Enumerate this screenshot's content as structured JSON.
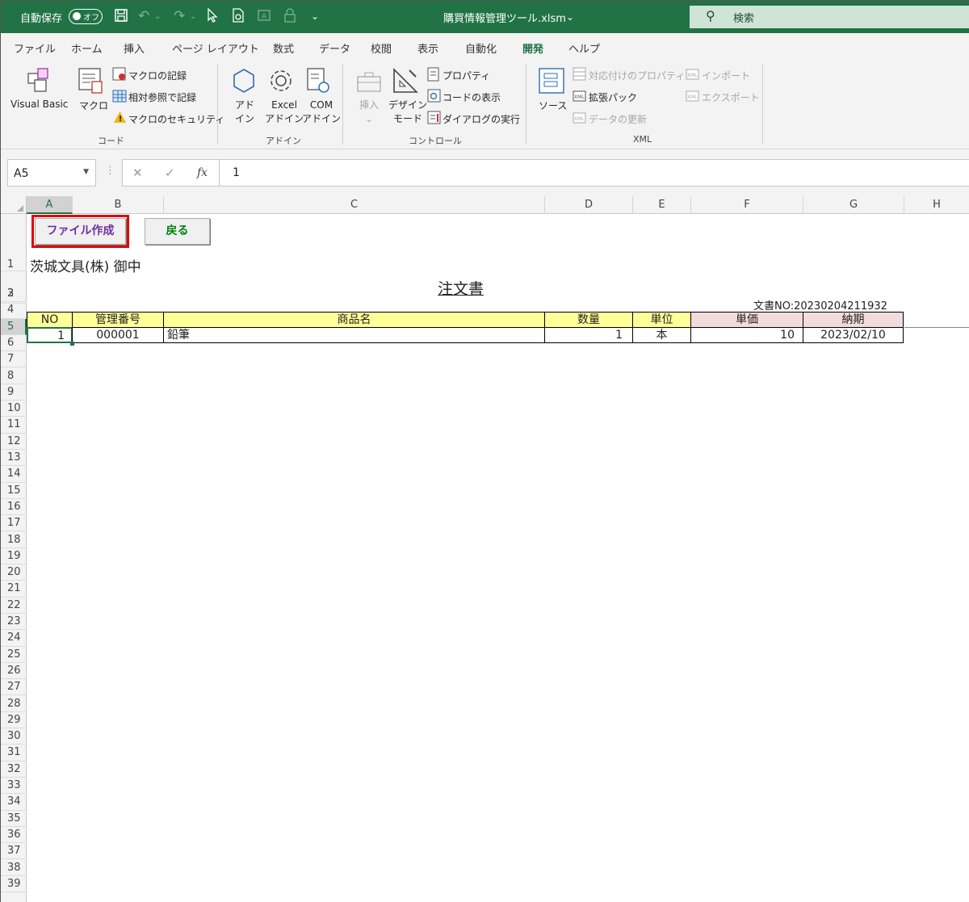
{
  "titlebar": {
    "autosave_label": "自動保存",
    "toggle_label": "オフ",
    "filename": "購買情報管理ツール.xlsm",
    "search_placeholder": "検索"
  },
  "tabs": [
    {
      "label": "ファイル"
    },
    {
      "label": "ホーム"
    },
    {
      "label": "挿入"
    },
    {
      "label": "ページ レイアウト"
    },
    {
      "label": "数式"
    },
    {
      "label": "データ"
    },
    {
      "label": "校閲"
    },
    {
      "label": "表示"
    },
    {
      "label": "自動化"
    },
    {
      "label": "開発",
      "active": true
    },
    {
      "label": "ヘルプ"
    }
  ],
  "ribbon": {
    "code": {
      "visual_basic": "Visual Basic",
      "macro": "マクロ",
      "record_macro": "マクロの記録",
      "relative_ref": "相対参照で記録",
      "macro_security": "マクロのセキュリティ",
      "group_label": "コード"
    },
    "addins": {
      "addin_l1": "アド",
      "addin_l2": "イン",
      "excel_l1": "Excel",
      "excel_l2": "アドイン",
      "com_l1": "COM",
      "com_l2": "アドイン",
      "group_label": "アドイン"
    },
    "controls": {
      "insert": "挿入",
      "design_l1": "デザイン",
      "design_l2": "モード",
      "properties": "プロパティ",
      "view_code": "コードの表示",
      "run_dialog": "ダイアログの実行",
      "group_label": "コントロール"
    },
    "xml": {
      "source": "ソース",
      "map_properties": "対応付けのプロパティ",
      "expansion_packs": "拡張パック",
      "refresh_data": "データの更新",
      "import": "インポート",
      "export": "エクスポート",
      "group_label": "XML"
    }
  },
  "formula_bar": {
    "name_box": "A5",
    "fx": "fx",
    "value": "1"
  },
  "columns": [
    "A",
    "B",
    "C",
    "D",
    "E",
    "F",
    "G",
    "H"
  ],
  "rows": [
    "1",
    "2",
    "3",
    "4",
    "5",
    "6",
    "7",
    "8",
    "9",
    "10",
    "11",
    "12",
    "13",
    "14",
    "15",
    "16",
    "17",
    "18",
    "19",
    "20",
    "21",
    "22",
    "23",
    "24",
    "25",
    "26",
    "27",
    "28",
    "29",
    "30",
    "31",
    "32",
    "33",
    "34",
    "35",
    "36",
    "37",
    "38",
    "39"
  ],
  "sheet": {
    "create_file_button": "ファイル作成",
    "back_button": "戻る",
    "addressee": "茨城文具(株) 御中",
    "title": "注文書",
    "doc_no": "文書NO:20230204211932",
    "headers": [
      "NO",
      "管理番号",
      "商品名",
      "数量",
      "単位",
      "単価",
      "納期"
    ],
    "row": {
      "no": "1",
      "code": "000001",
      "name": "鉛筆",
      "qty": "1",
      "unit": "本",
      "price": "10",
      "due": "2023/02/10"
    }
  },
  "colors": {
    "excel_green": "#217346",
    "header_yellow": "#ffff99",
    "header_pink": "#f2dcdb",
    "create_button_text": "#7030a0",
    "back_button_text": "#00800f",
    "highlight_border": "#e00000"
  }
}
